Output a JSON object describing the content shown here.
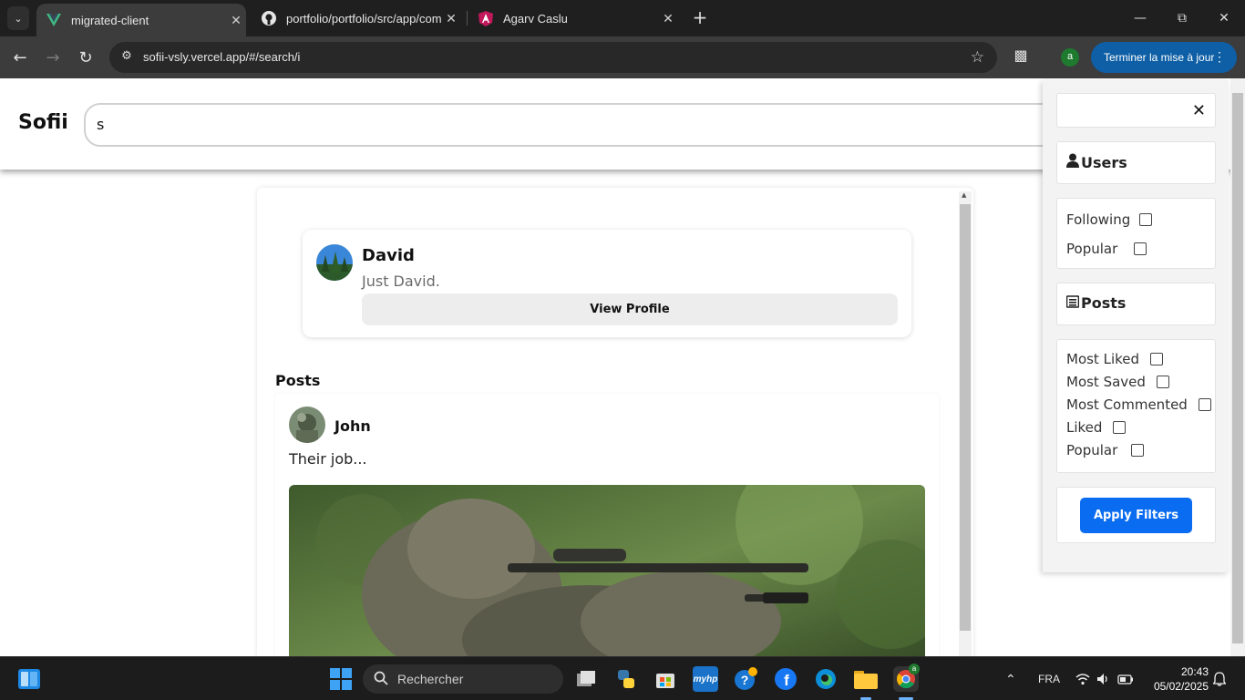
{
  "browser": {
    "tabs": [
      {
        "title": "migrated-client",
        "icon": "vue-icon",
        "active": true
      },
      {
        "title": "portfolio/portfolio/src/app/com",
        "icon": "github-icon",
        "active": false
      },
      {
        "title": "Agarv Caslu",
        "icon": "angular-icon",
        "active": false
      }
    ],
    "url": "sofii-vsly.vercel.app/#/search/i",
    "profile_initial": "a",
    "update_label": "Terminer la mise à jour"
  },
  "app": {
    "logo": "Sofii",
    "search_value": "s"
  },
  "results": {
    "user": {
      "name": "David",
      "bio": "Just David.",
      "view_profile_label": "View Profile"
    },
    "posts_heading": "Posts",
    "post": {
      "author": "John",
      "text": "Their job..."
    }
  },
  "filters": {
    "users_title": "Users",
    "user_options": [
      "Following",
      "Popular"
    ],
    "posts_title": "Posts",
    "post_options": [
      "Most Liked",
      "Most Saved",
      "Most Commented",
      "Liked",
      "Popular"
    ],
    "apply_label": "Apply Filters"
  },
  "taskbar": {
    "search_placeholder": "Rechercher",
    "language": "FRA",
    "time": "20:43",
    "date": "05/02/2025",
    "chrome_badge": "a"
  },
  "colors": {
    "accent": "#0a6cf0",
    "update_button": "#0e5fa5"
  }
}
